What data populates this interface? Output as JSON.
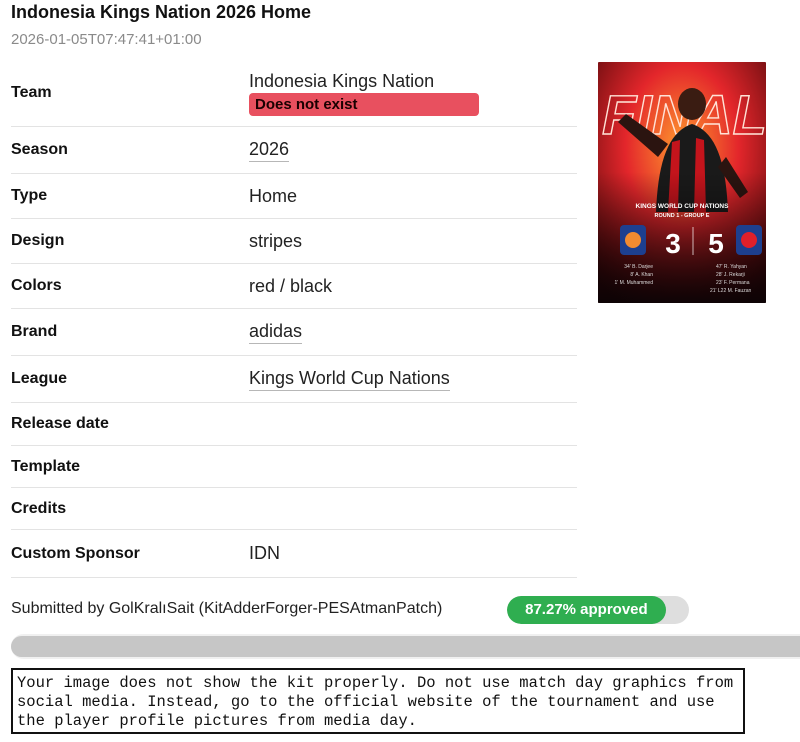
{
  "page": {
    "title": "Indonesia Kings Nation 2026 Home",
    "timestamp": "2026-01-05T07:47:41+01:00"
  },
  "details": {
    "team": {
      "label": "Team",
      "value": "Indonesia Kings Nation",
      "error": "Does not exist"
    },
    "season": {
      "label": "Season",
      "value": "2026"
    },
    "type": {
      "label": "Type",
      "value": "Home"
    },
    "design": {
      "label": "Design",
      "value": "stripes"
    },
    "colors": {
      "label": "Colors",
      "value": "red / black"
    },
    "brand": {
      "label": "Brand",
      "value": "adidas"
    },
    "league": {
      "label": "League",
      "value": "Kings World Cup Nations"
    },
    "release_date": {
      "label": "Release date",
      "value": ""
    },
    "template": {
      "label": "Template",
      "value": ""
    },
    "credits": {
      "label": "Credits",
      "value": ""
    },
    "custom_sponsor": {
      "label": "Custom Sponsor",
      "value": "IDN"
    }
  },
  "poster": {
    "headline": "FINAL",
    "tournament": "KINGS WORLD CUP NATIONS",
    "round": "ROUND 1 - GROUP E",
    "home_score": "3",
    "away_score": "5",
    "home_scorers": [
      "34' B. Darjee",
      "8' A. Khan",
      "1' M. Muhammed"
    ],
    "away_scorers": [
      "47' R. Yahyan",
      "28' J. Rekarji",
      "23' F. Permana",
      "21' L22 M. Fauzan"
    ]
  },
  "submission": {
    "text": "Submitted by GolKralıSait (KitAdderForger-PESAtmanPatch)",
    "approval_label": "87.27% approved",
    "approval_percent": 87.27
  },
  "comment": {
    "value": "Your image does not show the kit properly. Do not use match day graphics from social media. Instead, go to the official website of the tournament and use the player profile pictures from media day."
  },
  "colors": {
    "error": "#e8505f",
    "approved": "#2fae50"
  }
}
